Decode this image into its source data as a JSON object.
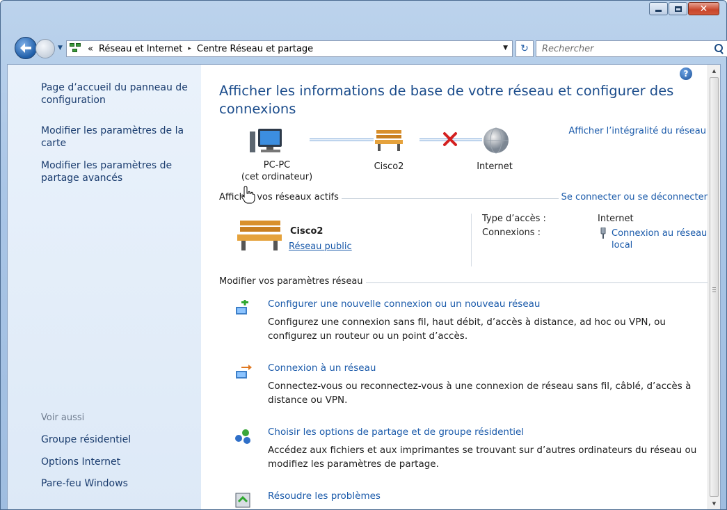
{
  "window": {
    "caption_buttons": {
      "minimize": "minimize",
      "maximize": "maximize",
      "close": "close"
    }
  },
  "navbar": {
    "breadcrumb": {
      "overflow": "«",
      "items": [
        "Réseau et Internet",
        "Centre Réseau et partage"
      ],
      "separator": "▸"
    },
    "search_placeholder": "Rechercher"
  },
  "sidebar": {
    "links": [
      "Page d’accueil du panneau de configuration",
      "Modifier les paramètres de la carte",
      "Modifier les paramètres de partage avancés"
    ],
    "see_also_caption": "Voir aussi",
    "see_also": [
      "Groupe résidentiel",
      "Options Internet",
      "Pare-feu Windows"
    ]
  },
  "main": {
    "title": "Afficher les informations de base de votre réseau et configurer des connexions",
    "map": {
      "full_map_link": "Afficher l’intégralité du réseau",
      "nodes": [
        {
          "label": "PC-PC",
          "sub": "(cet ordinateur)",
          "icon": "computer-icon"
        },
        {
          "label": "Cisco2",
          "sub": "",
          "icon": "bench-icon"
        },
        {
          "label": "Internet",
          "sub": "",
          "icon": "globe-icon"
        }
      ],
      "broken_link": "red-x-icon"
    },
    "active_networks": {
      "header": "Afficher vos réseaux actifs",
      "connect_link": "Se connecter ou se déconnecter",
      "network_name": "Cisco2",
      "network_type": "Réseau public",
      "access_type_label": "Type d’accès :",
      "access_type_value": "Internet",
      "connections_label": "Connexions :",
      "connections_value": "Connexion au réseau local"
    },
    "change_settings": {
      "header": "Modifier vos paramètres réseau",
      "tasks": [
        {
          "link": "Configurer une nouvelle connexion ou un nouveau réseau",
          "desc": "Configurez une connexion sans fil, haut débit, d’accès à distance, ad hoc ou VPN, ou configurez un routeur ou un point d’accès."
        },
        {
          "link": "Connexion à un réseau",
          "desc": "Connectez-vous ou reconnectez-vous à une connexion de réseau sans fil, câblé, d’accès à distance ou VPN."
        },
        {
          "link": "Choisir les options de partage et de groupe résidentiel",
          "desc": "Accédez aux fichiers et aux imprimantes se trouvant sur d’autres ordinateurs du réseau ou modifiez les paramètres de partage."
        },
        {
          "link": "Résoudre les problèmes",
          "desc": ""
        }
      ]
    }
  },
  "colors": {
    "link": "#1a5aaa",
    "title": "#1c4d8c",
    "sidebar_link": "#1a3c6e"
  }
}
